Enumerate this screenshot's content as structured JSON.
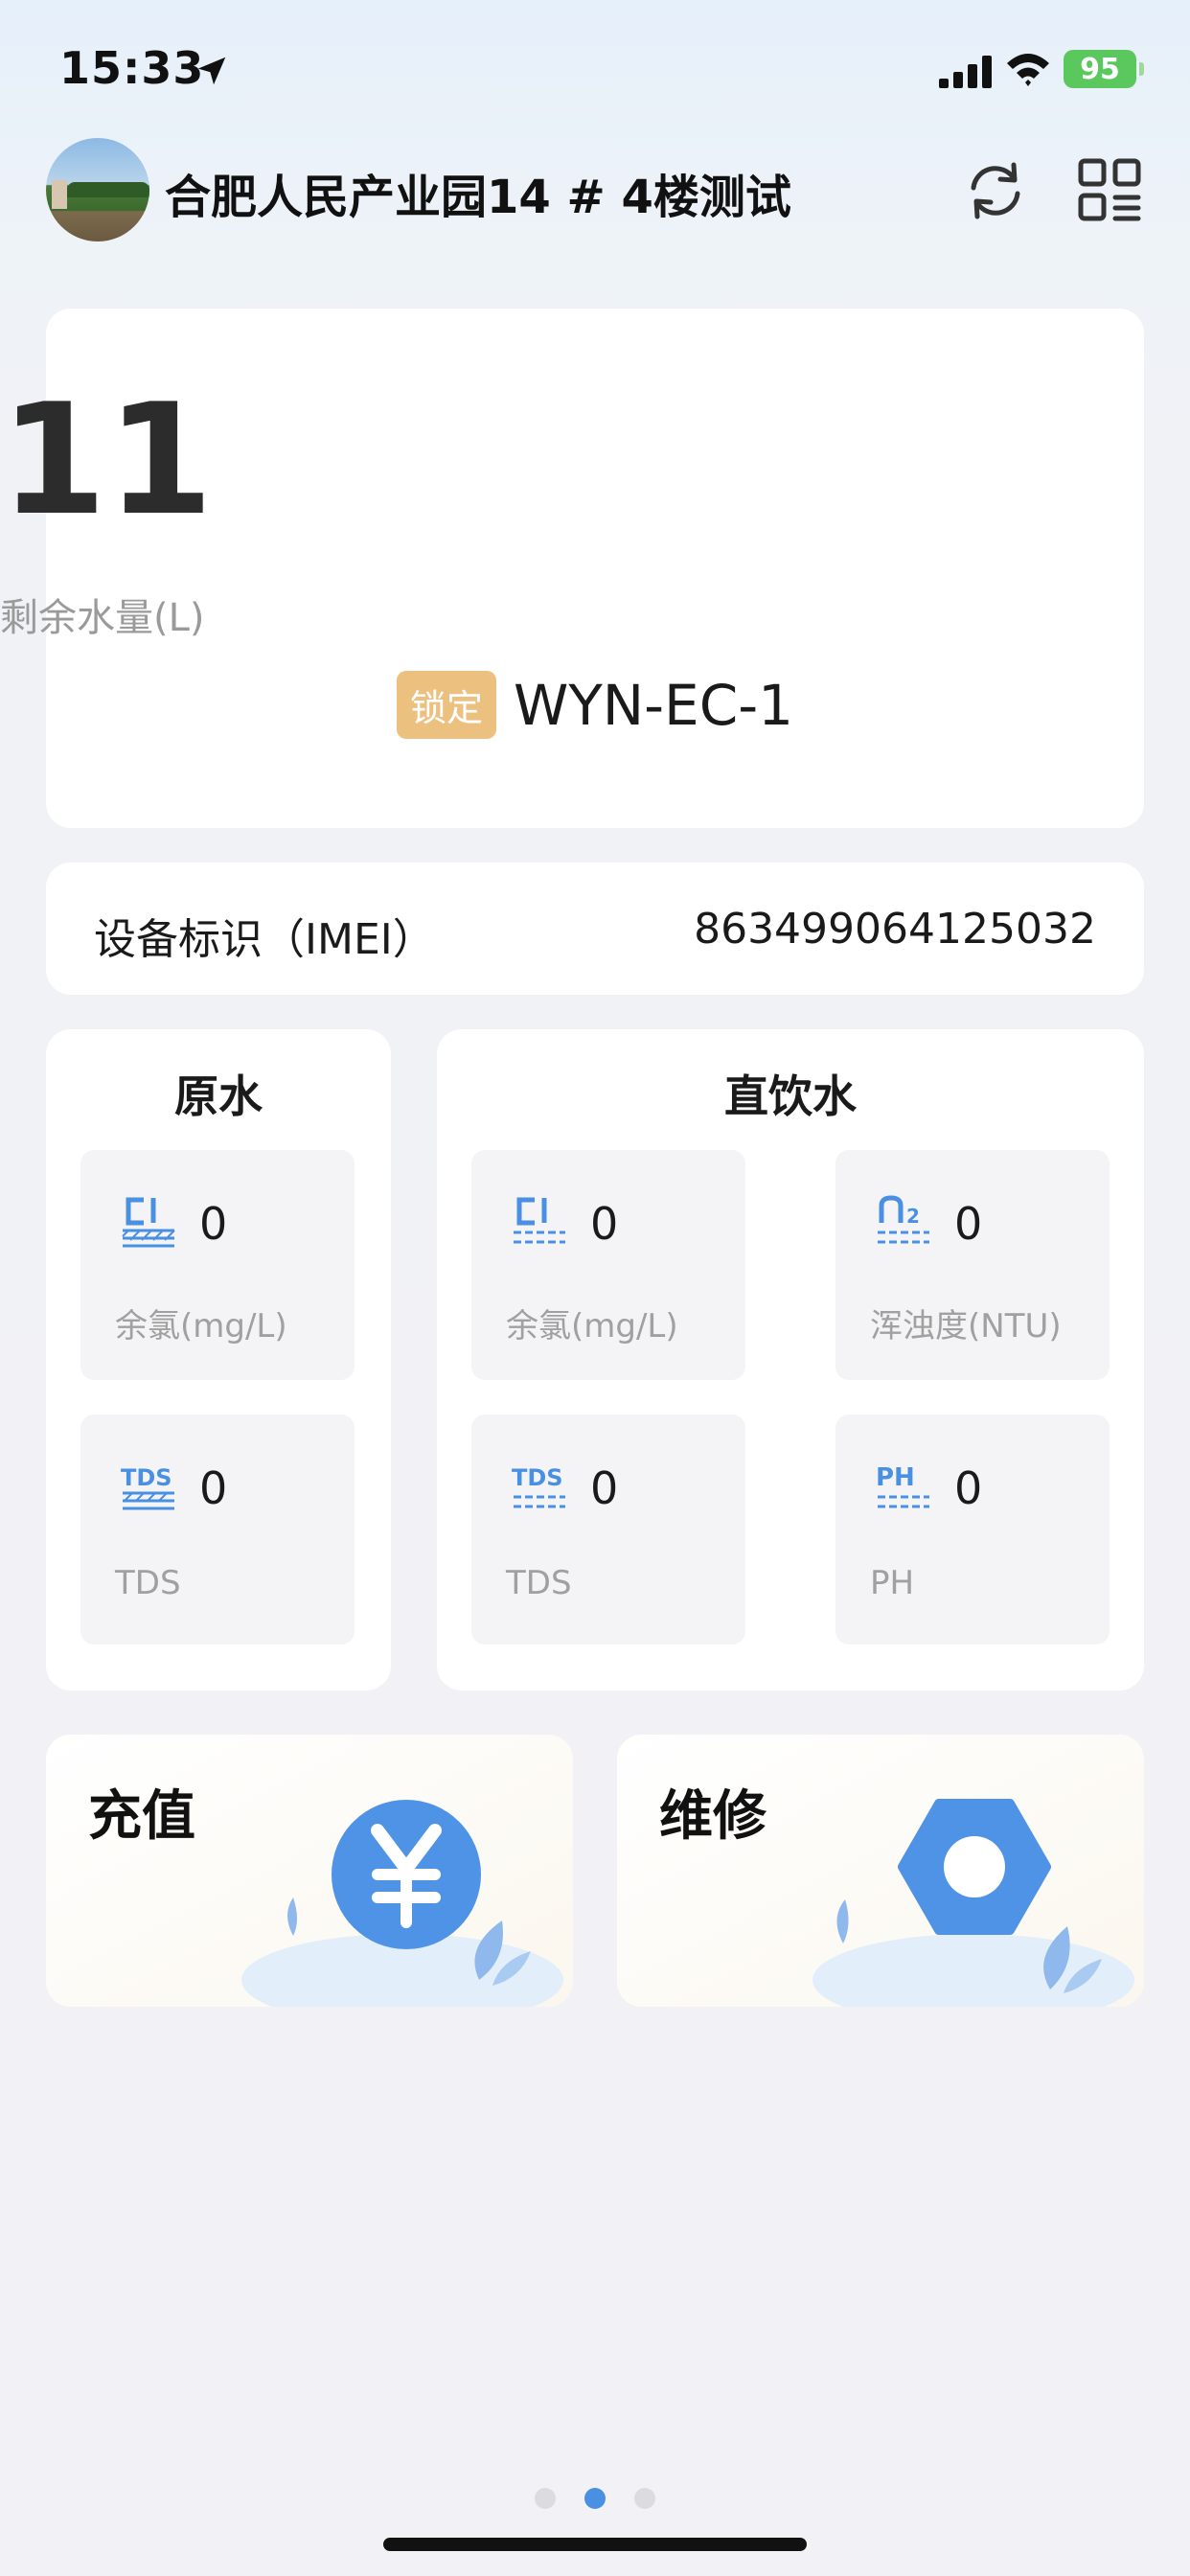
{
  "status": {
    "time": "15:33",
    "battery": "95"
  },
  "header": {
    "title": "合肥人民产业园14 # 4楼测试"
  },
  "main": {
    "remaining_value": "11",
    "remaining_label": "剩余水量(L)",
    "lock_badge": "锁定",
    "device_name": "WYN-EC-1"
  },
  "imei": {
    "label": "设备标识（IMEI）",
    "value": "863499064125032"
  },
  "raw_water": {
    "title": "原水",
    "metrics": [
      {
        "icon": "chlorine-icon",
        "value": "0",
        "label": "余氯(mg/L)"
      },
      {
        "icon": "tds-icon",
        "value": "0",
        "label": "TDS"
      }
    ]
  },
  "direct_water": {
    "title": "直饮水",
    "metrics": [
      {
        "icon": "chlorine-icon",
        "value": "0",
        "label": "余氯(mg/L)"
      },
      {
        "icon": "turbidity-icon",
        "value": "0",
        "label": "浑浊度(NTU)"
      },
      {
        "icon": "tds-icon",
        "value": "0",
        "label": "TDS"
      },
      {
        "icon": "ph-icon",
        "value": "0",
        "label": "PH"
      }
    ]
  },
  "actions": {
    "recharge": {
      "label": "充值",
      "icon": "yen-icon"
    },
    "repair": {
      "label": "维修",
      "icon": "nut-icon"
    }
  },
  "pager": {
    "count": 3,
    "active": 2
  },
  "colors": {
    "accent": "#4a90e2",
    "lock": "#ecc07f",
    "battery": "#5bc85d"
  }
}
